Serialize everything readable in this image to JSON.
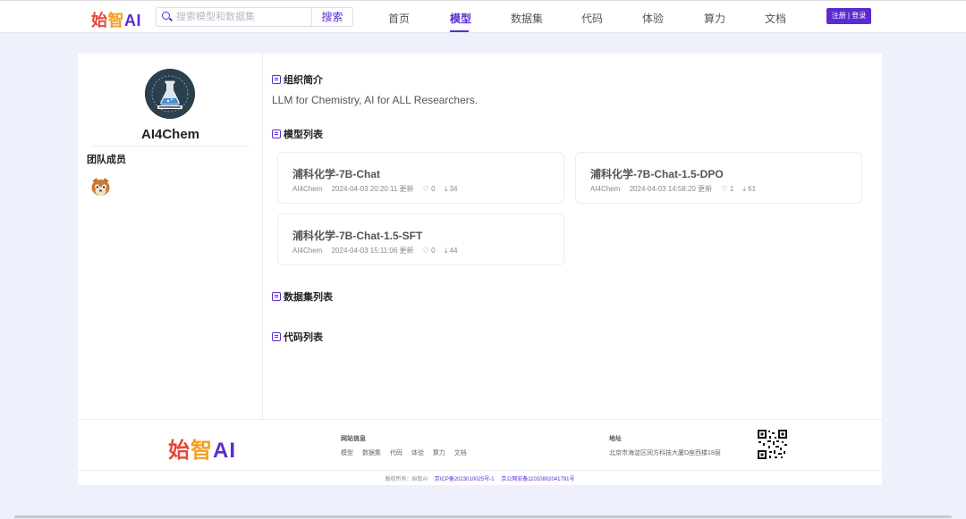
{
  "header": {
    "logo_a": "始",
    "logo_b": "智",
    "logo_c": "AI",
    "search_placeholder": "搜索模型和数据集",
    "search_button": "搜索",
    "nav": [
      {
        "label": "首页"
      },
      {
        "label": "模型"
      },
      {
        "label": "数据集"
      },
      {
        "label": "代码"
      },
      {
        "label": "体验"
      },
      {
        "label": "算力"
      },
      {
        "label": "文档"
      }
    ],
    "login": "注册 | 登录"
  },
  "org": {
    "name": "AI4Chem",
    "members_title": "团队成员"
  },
  "sections": {
    "intro_title": "组织简介",
    "intro_text": "LLM for Chemistry, AI for ALL Researchers.",
    "models_title": "模型列表",
    "datasets_title": "数据集列表",
    "code_title": "代码列表"
  },
  "models": [
    {
      "title": "浦科化学-7B-Chat",
      "org": "AI4Chem",
      "time": "2024-04-03 20:20:11 更新",
      "likes": "♡ 0",
      "downloads": "⤓ 34"
    },
    {
      "title": "浦科化学-7B-Chat-1.5-DPO",
      "org": "AI4Chem",
      "time": "2024-04-03 14:58:20 更新",
      "likes": "♡ 1",
      "downloads": "⤓ 61"
    },
    {
      "title": "浦科化学-7B-Chat-1.5-SFT",
      "org": "AI4Chem",
      "time": "2024-04-03 15:11:06 更新",
      "likes": "♡ 0",
      "downloads": "⤓ 44"
    }
  ],
  "footer": {
    "site_info": "网站信息",
    "links": [
      "模型",
      "数据集",
      "代码",
      "体验",
      "算力",
      "文档"
    ],
    "address_title": "地址",
    "address": "北京市海淀区同方科技大厦D座西楼18层",
    "copyright": "版权所有：始智AI",
    "icp": "京ICP备2023010025号-1",
    "police": "京公网安备11010802041791号"
  }
}
